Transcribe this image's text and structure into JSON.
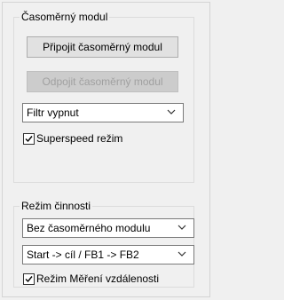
{
  "timer_group": {
    "title": "Časoměrný modul",
    "connect_label": "Připojit časoměrný modul",
    "disconnect_label": "Odpojit časoměrný modul",
    "filter_select": {
      "value": "Filtr vypnut"
    },
    "superspeed_checkbox": {
      "label": "Superspeed režim",
      "checked": true
    }
  },
  "mode_group": {
    "title": "Režim činnosti",
    "module_select": {
      "value": "Bez časoměrného modulu"
    },
    "route_select": {
      "value": "Start -> cíl / FB1 -> FB2"
    },
    "distance_checkbox": {
      "label": "Režim Měření vzdálenosti",
      "checked": true
    }
  },
  "icons": {
    "dropdown": "chevron-down-icon",
    "check": "checkmark-icon"
  },
  "colors": {
    "panel_bg": "#f0f0f0",
    "button_bg": "#e1e1e1",
    "disabled_text": "#a0a0a0"
  }
}
